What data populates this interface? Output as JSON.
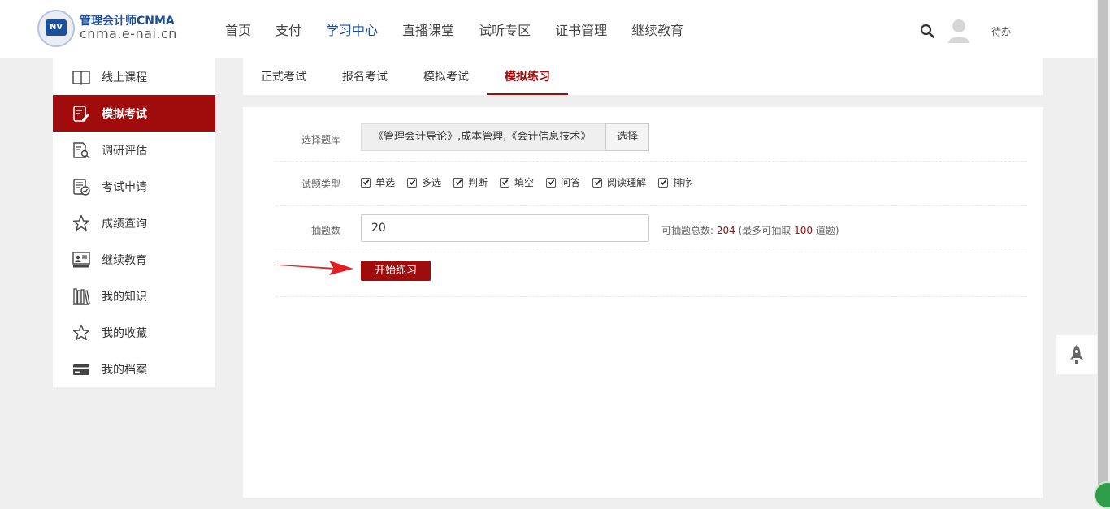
{
  "header": {
    "logo_title": "管理会计师CNMA",
    "logo_sub": "cnma.e-nai.cn",
    "nav": [
      "首页",
      "支付",
      "学习中心",
      "直播课堂",
      "试听专区",
      "证书管理",
      "继续教育"
    ],
    "active_nav": "学习中心",
    "todo": "待办"
  },
  "sidebar": {
    "items": [
      {
        "label": "线上课程",
        "icon": "book-icon"
      },
      {
        "label": "模拟考试",
        "icon": "edit-document-icon"
      },
      {
        "label": "调研评估",
        "icon": "document-search-icon"
      },
      {
        "label": "考试申请",
        "icon": "document-check-icon"
      },
      {
        "label": "成绩查询",
        "icon": "star-icon"
      },
      {
        "label": "继续教育",
        "icon": "teacher-board-icon"
      },
      {
        "label": "我的知识",
        "icon": "bookshelf-icon"
      },
      {
        "label": "我的收藏",
        "icon": "star-icon"
      },
      {
        "label": "我的档案",
        "icon": "id-card-icon"
      }
    ],
    "active": "模拟考试"
  },
  "tabs": {
    "items": [
      "正式考试",
      "报名考试",
      "模拟考试",
      "模拟练习"
    ],
    "active": "模拟练习"
  },
  "form": {
    "bank_label": "选择题库",
    "bank_value": "《管理会计导论》,成本管理,《会计信息技术》",
    "bank_button": "选择",
    "type_label": "试题类型",
    "types": [
      "单选",
      "多选",
      "判断",
      "填空",
      "问答",
      "阅读理解",
      "排序"
    ],
    "count_label": "抽题数",
    "count_value": "20",
    "info_prefix": "可抽题总数:",
    "info_total": "204",
    "info_mid": "(最多可抽取",
    "info_max": "100",
    "info_suffix": "道题)",
    "start_button": "开始练习"
  },
  "colors": {
    "accent": "#a00b0b",
    "nav_active": "#1a4fa0"
  }
}
